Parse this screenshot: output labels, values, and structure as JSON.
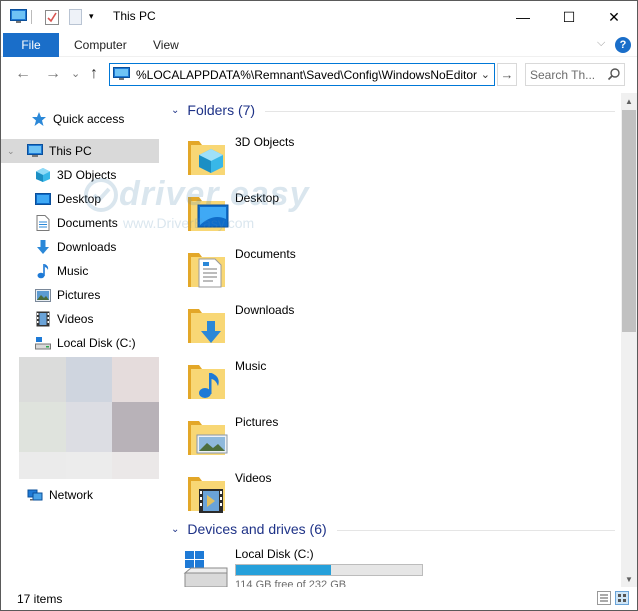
{
  "window": {
    "title": "This PC",
    "controls": {
      "minimize": "—",
      "maximize": "☐",
      "close": "✕"
    }
  },
  "ribbon": {
    "tabs": [
      "File",
      "Computer",
      "View"
    ],
    "expand_glyph": "⌵",
    "help_glyph": "?"
  },
  "nav": {
    "back": "←",
    "forward": "→",
    "recent": "⌄",
    "up": "↑",
    "address": "%LOCALAPPDATA%\\Remnant\\Saved\\Config\\WindowsNoEditor",
    "address_drop": "⌄",
    "go": "→",
    "search_placeholder": "Search Th..."
  },
  "sidebar": {
    "items": [
      {
        "label": "Quick access",
        "icon": "star-icon"
      },
      {
        "label": "This PC",
        "icon": "computer-icon",
        "selected": true
      },
      {
        "label": "3D Objects",
        "icon": "cube-icon"
      },
      {
        "label": "Desktop",
        "icon": "desktop-icon"
      },
      {
        "label": "Documents",
        "icon": "document-icon"
      },
      {
        "label": "Downloads",
        "icon": "download-arrow-icon"
      },
      {
        "label": "Music",
        "icon": "music-note-icon"
      },
      {
        "label": "Pictures",
        "icon": "picture-icon"
      },
      {
        "label": "Videos",
        "icon": "film-icon"
      },
      {
        "label": "Local Disk (C:)",
        "icon": "drive-icon"
      },
      {
        "label": "Network",
        "icon": "network-icon"
      }
    ]
  },
  "content": {
    "folders_header": "Folders (7)",
    "folders": [
      {
        "label": "3D Objects",
        "icon": "3d-objects-folder-icon"
      },
      {
        "label": "Desktop",
        "icon": "desktop-folder-icon"
      },
      {
        "label": "Documents",
        "icon": "documents-folder-icon"
      },
      {
        "label": "Downloads",
        "icon": "downloads-folder-icon"
      },
      {
        "label": "Music",
        "icon": "music-folder-icon"
      },
      {
        "label": "Pictures",
        "icon": "pictures-folder-icon"
      },
      {
        "label": "Videos",
        "icon": "videos-folder-icon"
      }
    ],
    "drives_header": "Devices and drives (6)",
    "drive": {
      "label": "Local Disk (C:)",
      "free_text": "114 GB free of 232 GB",
      "used_fraction": 0.509
    }
  },
  "status": {
    "items_count": "17 items"
  },
  "watermark": {
    "text": "driver easy",
    "url": "www.DriverEasy.com"
  },
  "colors": {
    "accent": "#1a6ec9",
    "selection": "#d9d9d9",
    "group_header": "#1e3287",
    "drive_fill": "#26a0da",
    "folder": "#f3c44f"
  }
}
